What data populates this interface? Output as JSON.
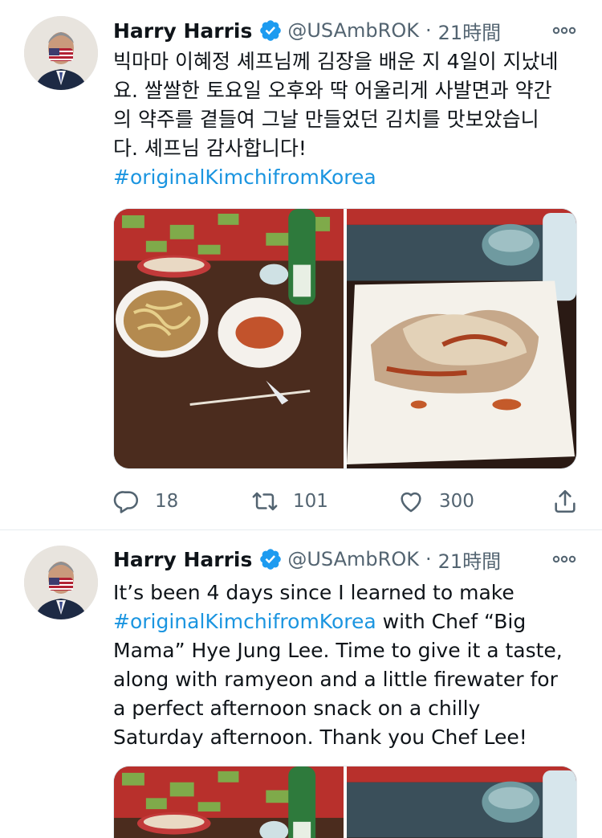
{
  "tweets": [
    {
      "name": "Harry Harris",
      "handle": "@USAmbROK",
      "separator": "·",
      "time": "21時間",
      "text": "빅마마 이혜정 셰프님께 김장을 배운 지 4일이 지났네\n요. 쌀쌀한 토요일 오후와 딱 어울리게 사발면과 약간\n의 약주를 곁들여 그날 만들었던 김치를 맛보았습니\n다. 셰프님 감사합니다!\n",
      "hashtag": "#originalKimchifromKorea",
      "counts": {
        "replies": "18",
        "retweets": "101",
        "likes": "300"
      }
    },
    {
      "name": "Harry Harris",
      "handle": "@USAmbROK",
      "separator": "·",
      "time": "21時間",
      "text_before": "It’s been 4 days since I learned to make\n",
      "hashtag": "#originalKimchifromKorea",
      "text_after": " with Chef “Big\nMama” Hye Jung Lee. Time to give it a taste,\nalong with ramyeon and a little firewater for\na perfect afternoon snack on a chilly\nSaturday afternoon. Thank you Chef Lee!"
    }
  ],
  "colors": {
    "accent": "#1b95e0",
    "verified": "#1d9bf0",
    "secondary_text": "#536471",
    "divider": "#e6ecf0"
  },
  "icons": [
    "verified-badge-icon",
    "more-options-icon",
    "reply-icon",
    "retweet-icon",
    "like-icon",
    "share-icon"
  ]
}
